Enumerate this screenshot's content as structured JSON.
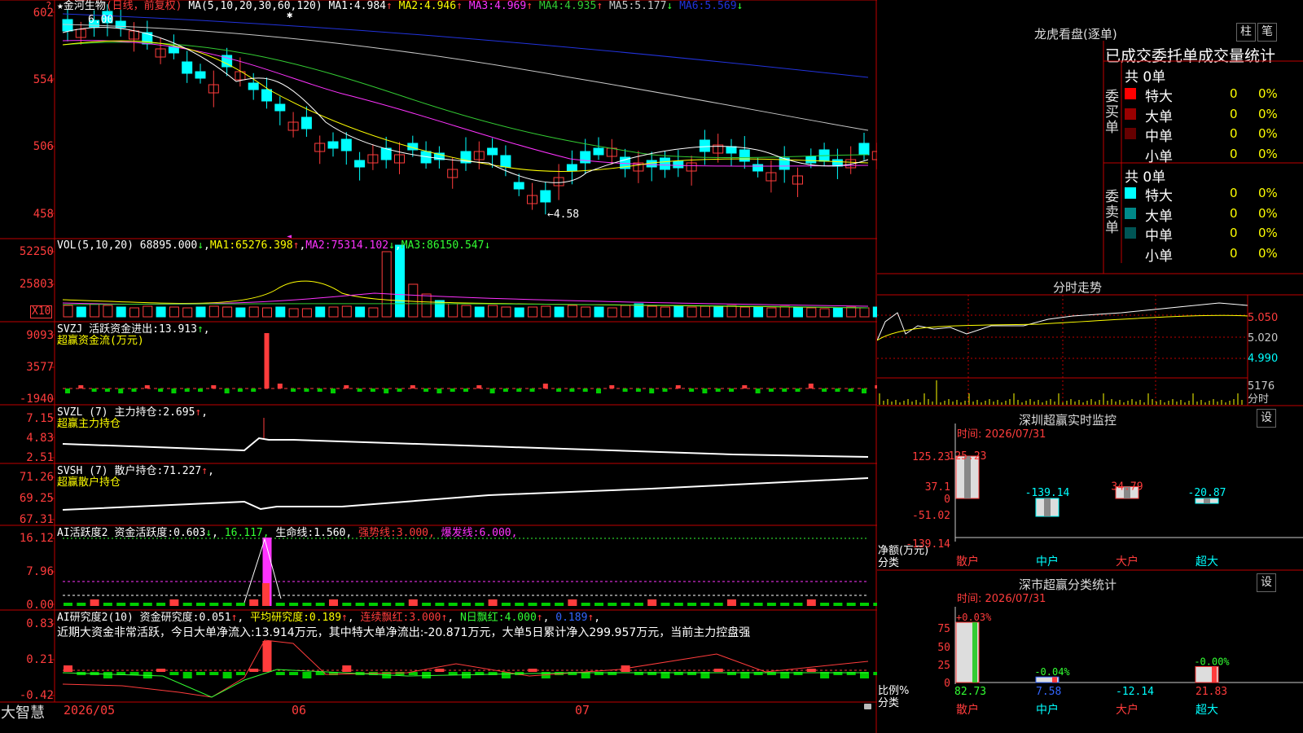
{
  "app": {
    "brand": "大智慧",
    "corner_icon": "question-icon"
  },
  "colors": {
    "up": "#ff3c3c",
    "down": "#00ffff",
    "grid": "#c00000",
    "bg": "#000000"
  },
  "stock": {
    "name": "金河生物",
    "period": "(日线，前复权)"
  },
  "main_axis": [
    "602",
    "554",
    "506",
    "458"
  ],
  "ma_header": {
    "label": "MA(5,10,20,30,60,120)",
    "items": [
      {
        "name": "MA1:",
        "value": "4.984",
        "arrow": "↑"
      },
      {
        "name": "MA2:",
        "value": "4.946",
        "arrow": "↑"
      },
      {
        "name": "MA3:",
        "value": "4.969",
        "arrow": "↑"
      },
      {
        "name": "MA4:",
        "value": "4.935",
        "arrow": "↑"
      },
      {
        "name": "MA5:",
        "value": "5.177",
        "arrow": "↓"
      },
      {
        "name": "MA6:",
        "value": "5.569",
        "arrow": "↓"
      }
    ],
    "ma_colors": [
      "#ffffff",
      "#ffff00",
      "#ff33ff",
      "#33cc33",
      "#c8c8c8",
      "#2233dd"
    ]
  },
  "annotations": {
    "high": "6.00",
    "low": "←4.58"
  },
  "vol": {
    "label": "VOL(5,10,20)",
    "value": "68895.000",
    "value_arrow": "↓",
    "items": [
      {
        "name": "MA1:",
        "value": "65276.398",
        "arrow": "↑"
      },
      {
        "name": "MA2:",
        "value": "75314.102",
        "arrow": "↓"
      },
      {
        "name": "MA3:",
        "value": "86150.547",
        "arrow": "↓"
      }
    ],
    "axis": [
      "52250",
      "25803"
    ],
    "unit": "X10"
  },
  "svzj": {
    "label": "SVZJ",
    "title": "活跃资金进出:",
    "value": "13.913",
    "arrow": "↑",
    "subtitle": "超赢资金流(万元)",
    "axis": [
      "9093",
      "3577",
      "-1940"
    ]
  },
  "svzl": {
    "label": "SVZL (7)",
    "title": "主力持仓:",
    "value": "2.695",
    "arrow": "↑",
    "subtitle": "超赢主力持仓",
    "axis": [
      "7.15",
      "4.83",
      "2.51"
    ]
  },
  "svsh": {
    "label": "SVSH (7)",
    "title": "散户持仓:",
    "value": "71.227",
    "arrow": "↑",
    "subtitle": "超赢散户持仓",
    "axis": [
      "71.26",
      "69.25",
      "67.31"
    ]
  },
  "ai1": {
    "label": "AI活跃度2",
    "axis": [
      "16.12",
      "7.96",
      "0.00"
    ],
    "items": [
      {
        "name": "资金活跃度:",
        "value": "0.603",
        "arrow": "↓",
        "sep": ",",
        "color": "#ffffff"
      },
      {
        "name": "",
        "value": "16.117",
        "arrow": "",
        "sep": ",",
        "color": "#33ff33"
      },
      {
        "name": "生命线:",
        "value": "1.560",
        "arrow": "",
        "sep": ",",
        "color": "#ffffff"
      },
      {
        "name": "强势线:",
        "value": "3.000",
        "arrow": "",
        "sep": ",",
        "color": "#ff3c3c"
      },
      {
        "name": "爆发线:",
        "value": "6.000",
        "arrow": "",
        "sep": ",",
        "color": "#ff33ff"
      }
    ]
  },
  "ai2": {
    "label": "AI研究度2(10)",
    "axis": [
      "0.83",
      "0.21",
      "-0.42"
    ],
    "items": [
      {
        "name": "资金研究度:",
        "value": "0.051",
        "arrow": "↑",
        "color": "#ffffff"
      },
      {
        "name": "平均研究度:",
        "value": "0.189",
        "arrow": "↑",
        "color": "#ffff00"
      },
      {
        "name": "连续飘红:",
        "value": "3.000",
        "arrow": "↑",
        "color": "#ff3c3c"
      },
      {
        "name": "N日飘红:",
        "value": "4.000",
        "arrow": "↑",
        "color": "#33ff33"
      },
      {
        "name": "",
        "value": "0.189",
        "arrow": "↑",
        "color": "#3366ff"
      }
    ],
    "message": "近期大资金非常活跃，今日大单净流入:13.914万元，其中特大单净流出:-20.871万元，大单5日累计净入299.957万元，当前主力控盘强"
  },
  "date_axis": [
    "2026/05",
    "06",
    "07"
  ],
  "lhb": {
    "title": "龙虎看盘(逐单)",
    "btn1": "柱",
    "btn2": "笔",
    "header": "已成交委托单成交量统计",
    "buy": {
      "side": "委买单",
      "total": "共 0单",
      "rows": [
        {
          "label": "特大",
          "count": "0",
          "pct": "0%",
          "color": "#ff0000"
        },
        {
          "label": "大单",
          "count": "0",
          "pct": "0%",
          "color": "#990000"
        },
        {
          "label": "中单",
          "count": "0",
          "pct": "0%",
          "color": "#660000"
        },
        {
          "label": "小单",
          "count": "0",
          "pct": "0%",
          "color": "#000000"
        }
      ]
    },
    "sell": {
      "side": "委卖单",
      "total": "共 0单",
      "rows": [
        {
          "label": "特大",
          "count": "0",
          "pct": "0%",
          "color": "#00ffff"
        },
        {
          "label": "大单",
          "count": "0",
          "pct": "0%",
          "color": "#008888"
        },
        {
          "label": "中单",
          "count": "0",
          "pct": "0%",
          "color": "#005555"
        },
        {
          "label": "小单",
          "count": "0",
          "pct": "0%",
          "color": "#000000"
        }
      ]
    }
  },
  "intraday": {
    "title": "分时走势",
    "axis": [
      "5.050",
      "5.020",
      "4.990"
    ],
    "vol_label": "5176",
    "vol_unit": "分时"
  },
  "monitor": {
    "title": "深圳超赢实时监控",
    "settings": "设",
    "time": "时间: 2026/07/31",
    "axis": [
      "125.23",
      "37.1",
      "0",
      "-51.02",
      "-139.14"
    ],
    "ylabel": "净额(万元)",
    "xlabel": "分类"
  },
  "classify": {
    "title": "深市超赢分类统计",
    "settings": "设",
    "time": "时间: 2026/07/31",
    "axis": [
      "75",
      "50",
      "25",
      "0"
    ],
    "ylabel": "比例%",
    "xlabel": "分类"
  },
  "chart_data": [
    {
      "type": "bar",
      "title": "深圳超赢实时监控",
      "categories": [
        "散户",
        "中户",
        "大户",
        "超大"
      ],
      "values": [
        125.23,
        -139.14,
        34.79,
        -20.87
      ],
      "labels": [
        "125.23",
        "-139.14",
        "34.79",
        "-20.87"
      ],
      "ylim": [
        -139.14,
        125.23
      ],
      "xlabel": "分类",
      "ylabel": "净额(万元)"
    },
    {
      "type": "bar",
      "title": "深市超赢分类统计",
      "categories": [
        "散户",
        "中户",
        "大户",
        "超大"
      ],
      "values": [
        82.73,
        7.58,
        -12.14,
        21.83
      ],
      "top_labels": [
        "+0.03%",
        "-0.04%",
        "",
        "-0.00%"
      ],
      "labels": [
        "82.73",
        "7.58",
        "-12.14",
        "21.83"
      ],
      "ylim": [
        0,
        75
      ],
      "xlabel": "分类",
      "ylabel": "比例%"
    }
  ]
}
